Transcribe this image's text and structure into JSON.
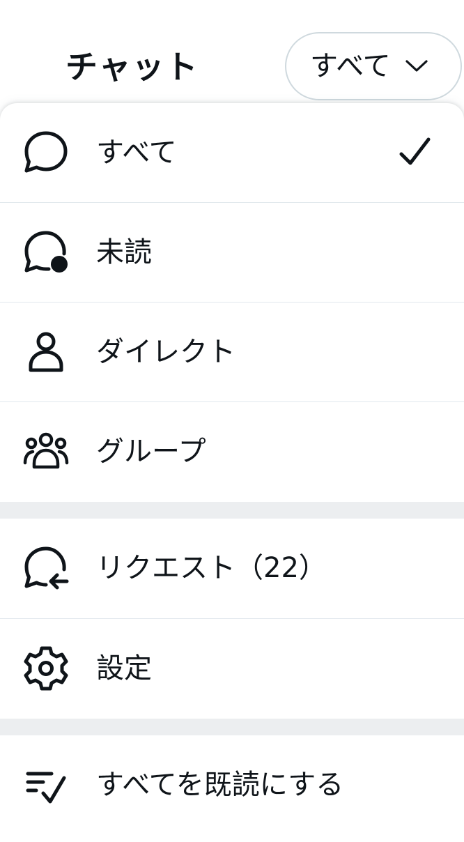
{
  "header": {
    "title": "チャット",
    "filter": {
      "label": "すべて",
      "icon": "chevron-down-icon"
    }
  },
  "menu": {
    "items": [
      {
        "label": "すべて",
        "icon": "chat-bubble-icon",
        "selected": true
      },
      {
        "label": "未読",
        "icon": "chat-bubble-unread-icon"
      },
      {
        "label": "ダイレクト",
        "icon": "person-icon"
      },
      {
        "label": "グループ",
        "icon": "group-icon"
      },
      {
        "label": "リクエスト（22）",
        "icon": "chat-bubble-request-icon"
      },
      {
        "label": "設定",
        "icon": "gear-icon"
      },
      {
        "label": "すべてを既読にする",
        "icon": "mark-all-read-icon"
      }
    ]
  },
  "colors": {
    "text": "#0f1419",
    "divider": "#e1e8ed",
    "band": "#eceef0",
    "pill_border": "#cfd9de"
  }
}
